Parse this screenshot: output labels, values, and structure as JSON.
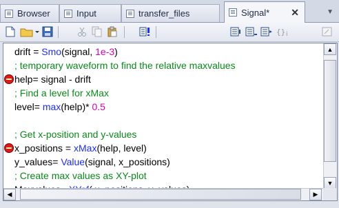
{
  "tabs": [
    {
      "label": "Browser",
      "active": false
    },
    {
      "label": "Input",
      "active": false
    },
    {
      "label": "transfer_files",
      "active": false
    },
    {
      "label": "Signal*",
      "active": true
    }
  ],
  "tab_close": "✕",
  "tab_overflow": "▼",
  "toolbar": {
    "icons": [
      "new-document-icon",
      "open-folder-icon",
      "save-icon",
      "cut-icon",
      "copy-icon",
      "paste-icon",
      "run-icon",
      "indent-icon",
      "outdent-icon",
      "insert-icon",
      "braces-icon",
      "format-icon"
    ]
  },
  "colors": {
    "comment": "#0a8a1a",
    "function": "#1a2dff",
    "number": "#d400b8",
    "breakpoint": "#e01818"
  },
  "code": {
    "lines": [
      {
        "parts": [
          {
            "t": "drift = "
          },
          {
            "t": "Smo",
            "c": "fn"
          },
          {
            "t": "(signal, "
          },
          {
            "t": "1e-3",
            "c": "num"
          },
          {
            "t": ")"
          }
        ],
        "breakpoint": false,
        "comment": false
      },
      {
        "parts": [
          {
            "t": "; temporary waveform to find the relative maxvalues"
          }
        ],
        "breakpoint": false,
        "comment": true
      },
      {
        "parts": [
          {
            "t": "help= signal - drift"
          }
        ],
        "breakpoint": true,
        "comment": false
      },
      {
        "parts": [
          {
            "t": "; Find a level for xMax"
          }
        ],
        "breakpoint": false,
        "comment": true
      },
      {
        "parts": [
          {
            "t": "level= "
          },
          {
            "t": "max",
            "c": "fn"
          },
          {
            "t": "(help)* "
          },
          {
            "t": "0.5",
            "c": "num"
          }
        ],
        "breakpoint": false,
        "comment": false
      },
      {
        "parts": [
          {
            "t": ""
          }
        ],
        "breakpoint": false,
        "comment": false
      },
      {
        "parts": [
          {
            "t": "; Get x-position and y-values"
          }
        ],
        "breakpoint": false,
        "comment": true
      },
      {
        "parts": [
          {
            "t": "x_positions = "
          },
          {
            "t": "xMax",
            "c": "fn"
          },
          {
            "t": "(help, level)"
          }
        ],
        "breakpoint": true,
        "comment": false
      },
      {
        "parts": [
          {
            "t": "y_values= "
          },
          {
            "t": "Value",
            "c": "fn"
          },
          {
            "t": "(signal, x_positions)"
          }
        ],
        "breakpoint": false,
        "comment": false
      },
      {
        "parts": [
          {
            "t": "; Create max values as XY-plot"
          }
        ],
        "breakpoint": false,
        "comment": true
      },
      {
        "parts": [
          {
            "t": "Maxvalues= "
          },
          {
            "t": "XYof",
            "c": "fn"
          },
          {
            "t": "( x_positions, y_values)"
          }
        ],
        "breakpoint": false,
        "comment": false
      }
    ]
  },
  "scrollbar": {
    "up": "▲",
    "down": "▼",
    "left": "◀",
    "right": "▶"
  }
}
